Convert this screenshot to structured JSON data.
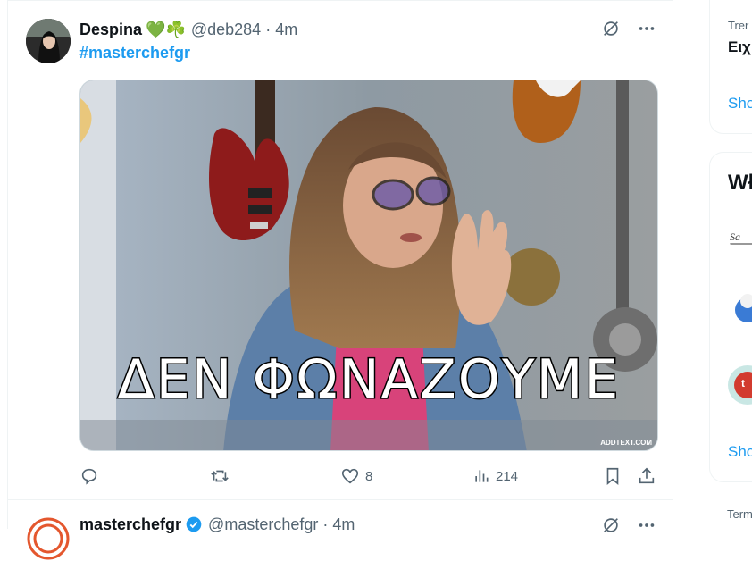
{
  "tweets": [
    {
      "name": "Despina",
      "emojis": "💚☘️",
      "handle": "@deb284",
      "separator": "·",
      "time": "4m",
      "text": "#masterchefgr",
      "media": {
        "caption": "ΔΕΝ ΦΩΝΑΖΟΥΜΕ",
        "watermark": "ADDTEXT.COM"
      },
      "stats": {
        "replies": "",
        "retweets": "",
        "likes": "8",
        "views": "214"
      }
    },
    {
      "name": "masterchefgr",
      "verified": true,
      "handle": "@masterchefgr",
      "separator": "·",
      "time": "4m"
    }
  ],
  "sidebar": {
    "trends": {
      "meta": "Trer",
      "name": "Ειχ",
      "show_more": "Sho"
    },
    "who_to_follow": {
      "title": "Wł",
      "show_more": "Sho"
    },
    "terms": "Term"
  },
  "colors": {
    "accent": "#1d9bf0",
    "muted": "#536471",
    "border": "#eff3f4"
  },
  "icons": [
    "grok-icon",
    "more-icon",
    "reply-icon",
    "retweet-icon",
    "like-icon",
    "views-icon",
    "bookmark-icon",
    "share-icon",
    "verified-icon"
  ]
}
